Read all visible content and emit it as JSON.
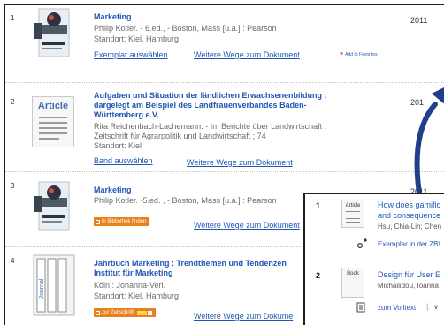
{
  "results": [
    {
      "number": "1",
      "thumbnail": "book-cover",
      "title": "Marketing",
      "meta": "Philip Kotler. - 6.ed., - Boston, Mass [u.a.] : Pearson",
      "location": "Standort: Kiel, Hamburg",
      "link_primary": "Exemplar auswählen",
      "link_secondary": "Weitere Wege zum Dokument",
      "favorite": "Add to Favorites",
      "year": "2011"
    },
    {
      "number": "2",
      "thumbnail_label": "Article",
      "title_lines": [
        "Aufgaben und Situation der ländlichen Erwachsenenbildung :",
        "dargelegt am Beispiel des Landfrauenverbandes Baden-",
        "Württemberg e.V."
      ],
      "meta_lines": [
        "Rita Reichenbach-Lachemann. - In: Berichte über Landwirtschaft :",
        "Zeitschrift für Agrarpolitik und Landwirtschaft ; 74"
      ],
      "location": "Standort: Kiel",
      "link_primary": "Band auswählen",
      "link_secondary": "Weitere Wege zum Dokument",
      "year": "201"
    },
    {
      "number": "3",
      "thumbnail": "book-cover",
      "title": "Marketing",
      "meta": "Philip Kotler. -5.ed. , - Boston, Mass [u.a.] : Pearson",
      "badge": "in Bibliothek finden",
      "link_secondary": "Weitere Wege zum Dokument",
      "year": "2011"
    },
    {
      "number": "4",
      "thumbnail_label": "Journal",
      "title_lines": [
        "Jahrbuch Marketing : Trendthemen und Tendenzen",
        "Institut für Marketing"
      ],
      "meta": "Köln : Johanna-Verl.",
      "location": "Standort: Kiel, Hamburg",
      "badge": "zur Zeitschrift",
      "link_secondary": "Weitere Wege zum Dokume"
    }
  ],
  "popup": {
    "items": [
      {
        "number": "1",
        "thumbnail_label": "Article",
        "title_lines": [
          "How does gamific",
          "and consequence"
        ],
        "meta": "Hsu, Chia-Lin; Chen",
        "link": "Exemplar in der ZB\\"
      },
      {
        "number": "2",
        "thumbnail_label": "Book",
        "title": "Design für User E",
        "meta": "Michailidou, Ioanna",
        "link": "zum Volltext",
        "dropdown_glyph": "∨"
      }
    ]
  },
  "colors": {
    "link": "#1f57b5",
    "badge": "#e8801c",
    "arrow": "#1f3f8a",
    "heart": "#e25b6e"
  },
  "icons": [
    "heart-icon",
    "library-icon",
    "journal-icons",
    "link-icon",
    "document-icon",
    "chevron-down-icon",
    "arrow-arc"
  ]
}
